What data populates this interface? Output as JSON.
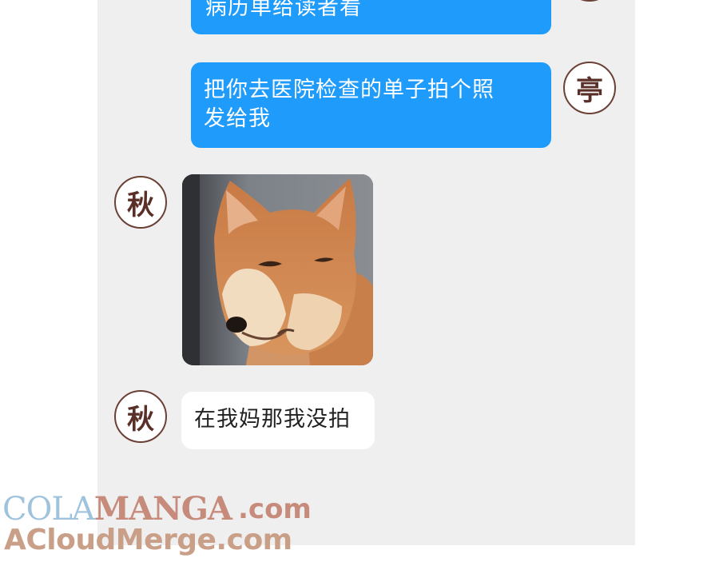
{
  "conversation": {
    "messages": [
      {
        "sender": "亭",
        "direction": "outgoing",
        "text": "病历单给读者看"
      },
      {
        "sender": "亭",
        "direction": "outgoing",
        "text": "把你去医院检查的单子拍个照\n发给我"
      },
      {
        "sender": "秋",
        "direction": "incoming",
        "type": "image"
      },
      {
        "sender": "秋",
        "direction": "incoming",
        "text": "在我妈那我没拍"
      }
    ],
    "avatars": {
      "self": "亭",
      "other": "秋"
    }
  },
  "colors": {
    "outgoing_bubble": "#1e9bfb",
    "incoming_bubble": "#ffffff",
    "chat_background": "#efefef",
    "avatar_ink": "#5a2f28"
  },
  "watermark": {
    "line1_part1": "COLA",
    "line1_part2": "MANGA",
    "line1_suffix": ".com",
    "line2": "ACloudMerge.com"
  },
  "icons": {
    "photo_message": "shiba-dog-photo"
  }
}
